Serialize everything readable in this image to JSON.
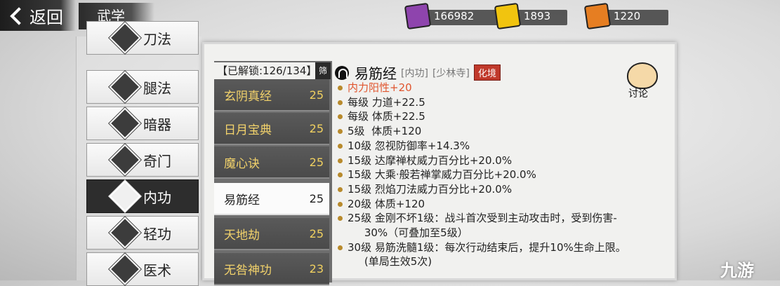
{
  "topbar": {
    "back_label": "返回",
    "section_title": "武学",
    "resources": [
      {
        "value": "166982",
        "color": "#8e44ad"
      },
      {
        "value": "1893",
        "color": "#f1c40f"
      },
      {
        "value": "1220",
        "color": "#e67e22"
      }
    ]
  },
  "categories": [
    {
      "label": "刀法",
      "icon": "blade-icon",
      "active": false
    },
    {
      "label": "腿法",
      "icon": "kick-icon",
      "active": false
    },
    {
      "label": "暗器",
      "icon": "shuriken-icon",
      "active": false
    },
    {
      "label": "奇门",
      "icon": "strange-weapon-icon",
      "active": false
    },
    {
      "label": "内功",
      "icon": "inner-power-icon",
      "active": true
    },
    {
      "label": "轻功",
      "icon": "lightness-icon",
      "active": false
    },
    {
      "label": "医术",
      "icon": "medicine-icon",
      "active": false
    }
  ],
  "skill_list": {
    "unlock_label": "【已解锁:126/134】",
    "filter_label": "筛",
    "items": [
      {
        "name": "玄阴真经",
        "level": "25",
        "active": false
      },
      {
        "name": "日月宝典",
        "level": "25",
        "active": false
      },
      {
        "name": "魔心诀",
        "level": "25",
        "active": false
      },
      {
        "name": "易筋经",
        "level": "25",
        "active": true
      },
      {
        "name": "天地劫",
        "level": "25",
        "active": false
      },
      {
        "name": "无咎神功",
        "level": "23",
        "active": false
      }
    ]
  },
  "detail": {
    "name": "易筋经",
    "type": "[内功]",
    "school": "[少林寺]",
    "badge": "化境",
    "effects": [
      {
        "text": "内力阳性+20",
        "highlight": true,
        "cont": false
      },
      {
        "text": "每级 力道+22.5",
        "highlight": false,
        "cont": false
      },
      {
        "text": "每级 体质+22.5",
        "highlight": false,
        "cont": false
      },
      {
        "text": "5级  体质+120",
        "highlight": false,
        "cont": false
      },
      {
        "text": "10级 忽视防御率+14.3%",
        "highlight": false,
        "cont": false
      },
      {
        "text": "15级 达摩禅杖威力百分比+20.0%",
        "highlight": false,
        "cont": false
      },
      {
        "text": "15级 大乘·般若禅掌威力百分比+20.0%",
        "highlight": false,
        "cont": false
      },
      {
        "text": "15级 烈焰刀法威力百分比+20.0%",
        "highlight": false,
        "cont": false
      },
      {
        "text": "20级 体质+120",
        "highlight": false,
        "cont": false
      },
      {
        "text": "25级 金刚不坏1级：战斗首次受到主动攻击时，受到伤害-",
        "highlight": false,
        "cont": false
      },
      {
        "text": "     30%（可叠加至5级）",
        "highlight": false,
        "cont": true
      },
      {
        "text": "30级 易筋洗髓1级：每次行动结束后，提升10%生命上限。",
        "highlight": false,
        "cont": false
      },
      {
        "text": "     (单局生效5次)",
        "highlight": false,
        "cont": true
      }
    ],
    "discuss_label": "讨论"
  },
  "watermark": "九游"
}
